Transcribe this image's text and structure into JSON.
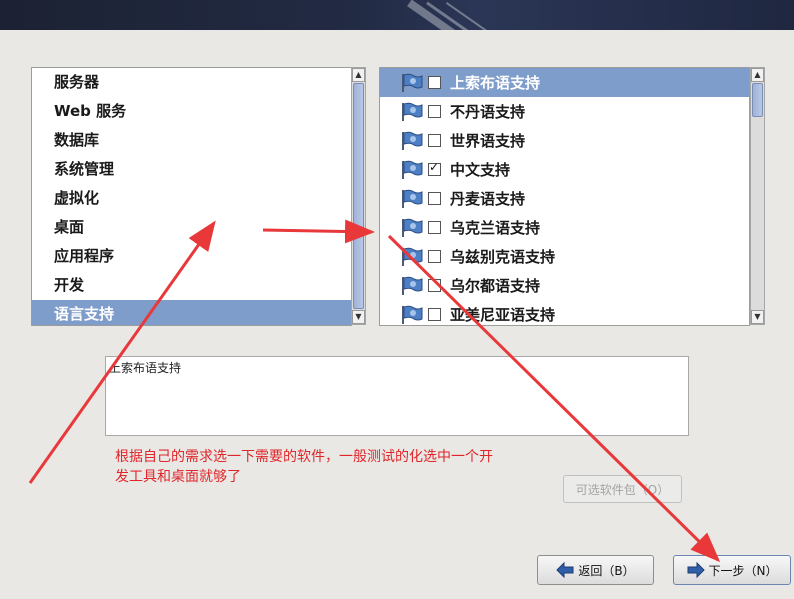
{
  "groups": [
    "服务器",
    "Web 服务",
    "数据库",
    "系统管理",
    "虚拟化",
    "桌面",
    "应用程序",
    "开发",
    "语言支持"
  ],
  "selected_group_index": 8,
  "packages": [
    {
      "label": "上索布语支持",
      "checked": false,
      "selected": true
    },
    {
      "label": "不丹语支持",
      "checked": false,
      "selected": false
    },
    {
      "label": "世界语支持",
      "checked": false,
      "selected": false
    },
    {
      "label": "中文支持",
      "checked": true,
      "selected": false
    },
    {
      "label": "丹麦语支持",
      "checked": false,
      "selected": false
    },
    {
      "label": "乌克兰语支持",
      "checked": false,
      "selected": false
    },
    {
      "label": "乌兹别克语支持",
      "checked": false,
      "selected": false
    },
    {
      "label": "乌尔都语支持",
      "checked": false,
      "selected": false
    },
    {
      "label": "亚美尼亚语支持",
      "checked": false,
      "selected": false
    }
  ],
  "description": "上索布语支持",
  "annotation": "根据自己的需求选一下需要的软件，一般测试的化选中一个开发工具和桌面就够了",
  "buttons": {
    "optional": "可选软件包（O）",
    "back": "返回（B）",
    "next": "下一步（N）"
  },
  "colors": {
    "selection": "#7f9dca",
    "annotation": "#e0262a",
    "banner": "#1c2233"
  },
  "icons": {
    "package_icon": "flag-icon",
    "back_icon": "arrow-left-icon",
    "next_icon": "arrow-right-icon"
  }
}
